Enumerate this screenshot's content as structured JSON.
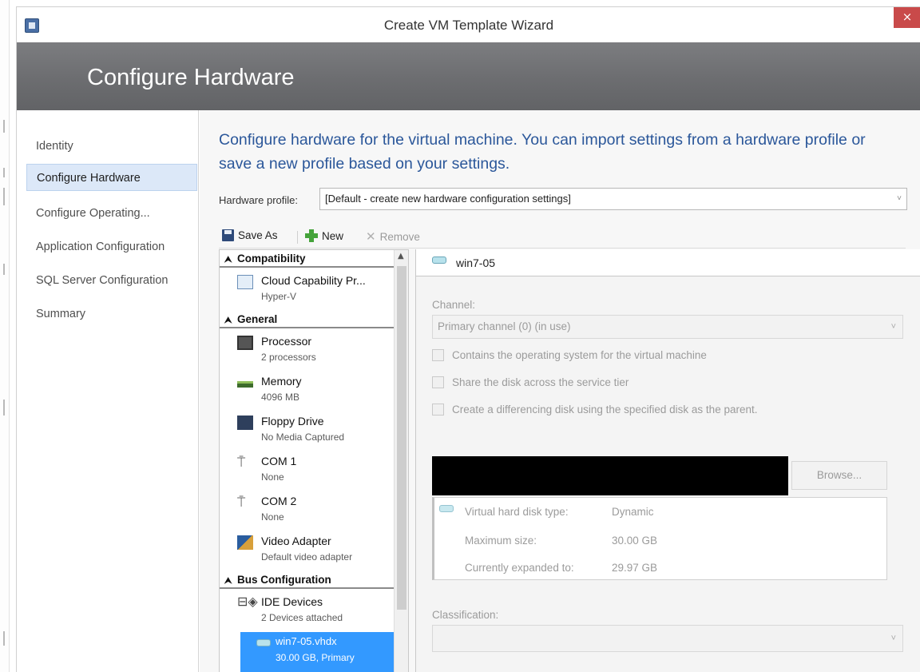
{
  "window": {
    "title": "Create VM Template Wizard",
    "close": "×"
  },
  "banner": {
    "title": "Configure Hardware"
  },
  "sidebar": {
    "items": [
      {
        "label": "Identity",
        "active": false
      },
      {
        "label": "Configure Hardware",
        "active": true
      },
      {
        "label": "Configure Operating...",
        "active": false
      },
      {
        "label": "Application Configuration",
        "active": false
      },
      {
        "label": "SQL Server Configuration",
        "active": false
      },
      {
        "label": "Summary",
        "active": false
      }
    ]
  },
  "main": {
    "heading": "Configure hardware for the virtual machine. You can import settings from a hardware profile or save a new profile based on your settings.",
    "hardware_profile": {
      "label": "Hardware profile:",
      "value": "[Default - create new hardware configuration settings]"
    },
    "toolbar": {
      "save_as": "Save As",
      "new": "New",
      "remove": "Remove"
    },
    "tree": {
      "groups": [
        {
          "label": "Compatibility",
          "items": [
            {
              "icon": "cloud-capability-icon",
              "name": "Cloud Capability Pr...",
              "sub": "Hyper-V"
            }
          ]
        },
        {
          "label": "General",
          "items": [
            {
              "icon": "processor-icon",
              "name": "Processor",
              "sub": "2 processors"
            },
            {
              "icon": "memory-icon",
              "name": "Memory",
              "sub": "4096 MB"
            },
            {
              "icon": "floppy-drive-icon",
              "name": "Floppy Drive",
              "sub": "No Media Captured"
            },
            {
              "icon": "com-port-icon",
              "name": "COM 1",
              "sub": "None"
            },
            {
              "icon": "com-port-icon",
              "name": "COM 2",
              "sub": "None"
            },
            {
              "icon": "video-adapter-icon",
              "name": "Video Adapter",
              "sub": "Default video adapter"
            }
          ]
        },
        {
          "label": "Bus Configuration",
          "items": [
            {
              "icon": "ide-devices-icon",
              "name": "IDE Devices",
              "sub": "2 Devices attached"
            },
            {
              "icon": "virtual-disk-icon",
              "name": "win7-05.vhdx",
              "sub": "30.00 GB, Primary",
              "selected": true
            }
          ]
        }
      ]
    },
    "detail": {
      "title": "win7-05",
      "channel_label": "Channel:",
      "channel_value": "Primary channel (0) (in use)",
      "checkboxes": [
        "Contains the operating system for the virtual machine",
        "Share the disk across the service tier",
        "Create a differencing disk using the specified disk as the parent."
      ],
      "browse": "Browse...",
      "vhd": [
        {
          "key": "Virtual hard disk type:",
          "value": "Dynamic"
        },
        {
          "key": "Maximum size:",
          "value": "30.00 GB"
        },
        {
          "key": "Currently expanded to:",
          "value": "29.97 GB"
        }
      ],
      "classification_label": "Classification:",
      "classification_value": ""
    }
  }
}
